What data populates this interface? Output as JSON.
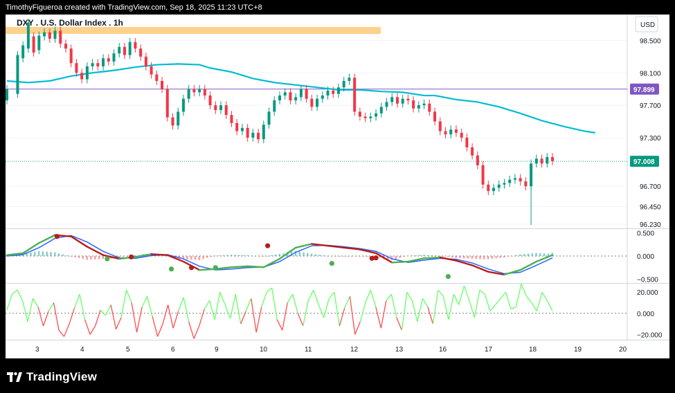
{
  "header": {
    "credit": "TimothyFigueroa created with TradingView.com, Sep 18, 2025 11:23 UTC+8"
  },
  "chart_data": {
    "type": "candlestick",
    "title": "DXY . U.S. Dollar Index . 1h",
    "currency": "USD",
    "x_tick_labels": [
      "3",
      "4",
      "5",
      "6",
      "9",
      "10",
      "11",
      "12",
      "13",
      "16",
      "17",
      "18",
      "19",
      "20"
    ],
    "main": {
      "y_ticks": [
        98.5,
        98.1,
        97.7,
        97.3,
        96.7,
        96.45,
        96.23
      ],
      "y_tick_labels": [
        "98.500",
        "98.100",
        "97.700",
        "97.300",
        "96.700",
        "96.450",
        "96.230"
      ],
      "ylim": [
        96.18,
        98.82
      ],
      "last_price": 97.008,
      "last_price_label": "97.008",
      "horizontal_level": 97.899,
      "horizontal_level_label": "97.899",
      "last_price_color": "#089981",
      "level_color": "#7E57C2",
      "moving_average_color": "#00BCD4",
      "moving_average": [
        [
          0,
          98.0
        ],
        [
          4,
          97.98
        ],
        [
          8,
          98.0
        ],
        [
          12,
          98.06
        ],
        [
          16,
          98.1
        ],
        [
          20,
          98.13
        ],
        [
          24,
          98.17
        ],
        [
          28,
          98.2
        ],
        [
          32,
          98.21
        ],
        [
          36,
          98.2
        ],
        [
          38,
          98.16
        ],
        [
          42,
          98.11
        ],
        [
          46,
          98.03
        ],
        [
          50,
          97.98
        ],
        [
          54,
          97.95
        ],
        [
          58,
          97.92
        ],
        [
          62,
          97.89
        ],
        [
          66,
          97.89
        ],
        [
          70,
          97.87
        ],
        [
          74,
          97.86
        ],
        [
          78,
          97.82
        ],
        [
          80,
          97.82
        ],
        [
          84,
          97.77
        ],
        [
          88,
          97.74
        ],
        [
          92,
          97.68
        ],
        [
          96,
          97.6
        ],
        [
          100,
          97.51
        ],
        [
          104,
          97.44
        ],
        [
          108,
          97.38
        ],
        [
          110,
          97.36
        ]
      ],
      "candles": [
        [
          0,
          97.76,
          97.9
        ],
        [
          2,
          97.84,
          98.32
        ],
        [
          3,
          98.28,
          98.44
        ],
        [
          4,
          98.4,
          98.72
        ],
        [
          5,
          98.55,
          98.35
        ],
        [
          6,
          98.38,
          98.56
        ],
        [
          7,
          98.55,
          98.6
        ],
        [
          8,
          98.6,
          98.52
        ],
        [
          9,
          98.52,
          98.62
        ],
        [
          10,
          98.62,
          98.46
        ],
        [
          11,
          98.46,
          98.4
        ],
        [
          12,
          98.4,
          98.22
        ],
        [
          13,
          98.22,
          98.1
        ],
        [
          14,
          98.1,
          98.02
        ],
        [
          15,
          98.02,
          98.18
        ],
        [
          16,
          98.18,
          98.22
        ],
        [
          17,
          98.22,
          98.18
        ],
        [
          18,
          98.18,
          98.28
        ],
        [
          19,
          98.28,
          98.24
        ],
        [
          20,
          98.24,
          98.34
        ],
        [
          21,
          98.34,
          98.42
        ],
        [
          22,
          98.42,
          98.32
        ],
        [
          23,
          98.32,
          98.48
        ],
        [
          24,
          98.48,
          98.4
        ],
        [
          25,
          98.4,
          98.3
        ],
        [
          26,
          98.3,
          98.18
        ],
        [
          27,
          98.18,
          98.08
        ],
        [
          28,
          98.08,
          98.0
        ],
        [
          29,
          98.0,
          97.9
        ],
        [
          30,
          97.9,
          97.55
        ],
        [
          31,
          97.55,
          97.45
        ],
        [
          32,
          97.45,
          97.62
        ],
        [
          33,
          97.62,
          97.78
        ],
        [
          34,
          97.78,
          97.9
        ],
        [
          35,
          97.9,
          97.86
        ],
        [
          36,
          97.86,
          97.9
        ],
        [
          37,
          97.9,
          97.82
        ],
        [
          38,
          97.82,
          97.7
        ],
        [
          39,
          97.7,
          97.64
        ],
        [
          40,
          97.64,
          97.7
        ],
        [
          41,
          97.7,
          97.58
        ],
        [
          42,
          97.58,
          97.48
        ],
        [
          43,
          97.48,
          97.38
        ],
        [
          44,
          97.38,
          97.42
        ],
        [
          45,
          97.42,
          97.3
        ],
        [
          46,
          97.3,
          97.36
        ],
        [
          47,
          97.36,
          97.28
        ],
        [
          48,
          97.28,
          97.46
        ],
        [
          49,
          97.46,
          97.62
        ],
        [
          50,
          97.62,
          97.76
        ],
        [
          51,
          97.76,
          97.82
        ],
        [
          52,
          97.82,
          97.86
        ],
        [
          53,
          97.86,
          97.76
        ],
        [
          54,
          97.76,
          97.8
        ],
        [
          55,
          97.8,
          97.9
        ],
        [
          56,
          97.9,
          97.78
        ],
        [
          57,
          97.78,
          97.68
        ],
        [
          58,
          97.68,
          97.78
        ],
        [
          59,
          97.78,
          97.82
        ],
        [
          60,
          97.82,
          97.88
        ],
        [
          61,
          97.88,
          97.84
        ],
        [
          62,
          97.84,
          97.92
        ],
        [
          63,
          97.92,
          98.0
        ],
        [
          64,
          98.0,
          98.04
        ],
        [
          65,
          98.04,
          97.62
        ],
        [
          66,
          97.62,
          97.56
        ],
        [
          67,
          97.56,
          97.54
        ],
        [
          68,
          97.54,
          97.56
        ],
        [
          69,
          97.56,
          97.6
        ],
        [
          70,
          97.6,
          97.68
        ],
        [
          71,
          97.68,
          97.74
        ],
        [
          72,
          97.74,
          97.8
        ],
        [
          73,
          97.8,
          97.72
        ],
        [
          74,
          97.72,
          97.78
        ],
        [
          75,
          97.78,
          97.76
        ],
        [
          76,
          97.76,
          97.66
        ],
        [
          77,
          97.66,
          97.7
        ],
        [
          78,
          97.7,
          97.72
        ],
        [
          79,
          97.72,
          97.62
        ],
        [
          80,
          97.62,
          97.5
        ],
        [
          81,
          97.5,
          97.38
        ],
        [
          82,
          97.38,
          97.34
        ],
        [
          83,
          97.34,
          97.4
        ],
        [
          84,
          97.4,
          97.36
        ],
        [
          85,
          97.36,
          97.3
        ],
        [
          86,
          97.3,
          97.18
        ],
        [
          87,
          97.18,
          97.08
        ],
        [
          88,
          97.08,
          96.96
        ],
        [
          89,
          96.96,
          96.72
        ],
        [
          90,
          96.72,
          96.64
        ],
        [
          91,
          96.64,
          96.68
        ],
        [
          92,
          96.68,
          96.72
        ],
        [
          93,
          96.72,
          96.74
        ],
        [
          94,
          96.74,
          96.78
        ],
        [
          95,
          96.78,
          96.8
        ],
        [
          96,
          96.8,
          96.76
        ],
        [
          97,
          96.76,
          96.7
        ],
        [
          98,
          96.7,
          96.98
        ],
        [
          99,
          96.98,
          97.04
        ],
        [
          100,
          97.04,
          96.98
        ],
        [
          101,
          96.98,
          97.06
        ],
        [
          102,
          97.06,
          97.01
        ]
      ]
    },
    "oscillator_1": {
      "y_ticks": [
        0.5,
        0.0,
        -0.5
      ],
      "y_tick_labels": [
        "0.500",
        "0.000",
        "−0.500"
      ],
      "ylim": [
        -0.58,
        0.58
      ],
      "fast_line": [
        [
          0,
          0.02
        ],
        [
          4,
          0.06
        ],
        [
          8,
          0.28
        ],
        [
          12,
          0.45
        ],
        [
          16,
          0.42
        ],
        [
          20,
          0.2
        ],
        [
          24,
          0.02
        ],
        [
          28,
          -0.06
        ],
        [
          32,
          -0.02
        ],
        [
          36,
          0.04
        ],
        [
          40,
          0.02
        ],
        [
          44,
          -0.12
        ],
        [
          48,
          -0.3
        ],
        [
          52,
          -0.28
        ],
        [
          56,
          -0.24
        ],
        [
          60,
          -0.22
        ],
        [
          64,
          -0.24
        ],
        [
          68,
          -0.06
        ],
        [
          72,
          0.18
        ],
        [
          76,
          0.26
        ],
        [
          80,
          0.22
        ],
        [
          84,
          0.18
        ],
        [
          88,
          0.14
        ],
        [
          92,
          0.06
        ],
        [
          96,
          -0.14
        ],
        [
          100,
          -0.12
        ],
        [
          104,
          -0.05
        ],
        [
          108,
          -0.03
        ],
        [
          112,
          -0.1
        ],
        [
          116,
          -0.2
        ],
        [
          120,
          -0.34
        ],
        [
          124,
          -0.4
        ],
        [
          128,
          -0.3
        ],
        [
          132,
          -0.12
        ],
        [
          136,
          0.02
        ]
      ],
      "slow_line": [
        [
          0,
          0.0
        ],
        [
          4,
          0.03
        ],
        [
          8,
          0.18
        ],
        [
          12,
          0.38
        ],
        [
          16,
          0.44
        ],
        [
          20,
          0.3
        ],
        [
          24,
          0.1
        ],
        [
          28,
          -0.04
        ],
        [
          32,
          -0.05
        ],
        [
          36,
          0.01
        ],
        [
          40,
          0.03
        ],
        [
          44,
          -0.06
        ],
        [
          48,
          -0.22
        ],
        [
          52,
          -0.3
        ],
        [
          56,
          -0.28
        ],
        [
          60,
          -0.25
        ],
        [
          64,
          -0.24
        ],
        [
          68,
          -0.12
        ],
        [
          72,
          0.08
        ],
        [
          76,
          0.22
        ],
        [
          80,
          0.23
        ],
        [
          84,
          0.2
        ],
        [
          88,
          0.16
        ],
        [
          92,
          0.1
        ],
        [
          96,
          -0.06
        ],
        [
          100,
          -0.14
        ],
        [
          104,
          -0.09
        ],
        [
          108,
          -0.05
        ],
        [
          112,
          -0.07
        ],
        [
          116,
          -0.15
        ],
        [
          120,
          -0.28
        ],
        [
          124,
          -0.38
        ],
        [
          128,
          -0.35
        ],
        [
          132,
          -0.2
        ],
        [
          136,
          -0.04
        ]
      ],
      "cross_markers": [
        [
          12.5,
          0.42,
          "red"
        ],
        [
          25,
          -0.06,
          "green"
        ],
        [
          31,
          -0.02,
          "red"
        ],
        [
          41,
          -0.28,
          "green"
        ],
        [
          46,
          -0.25,
          "red"
        ],
        [
          52,
          -0.25,
          "green"
        ],
        [
          65,
          0.22,
          "red"
        ],
        [
          81,
          -0.16,
          "green"
        ],
        [
          91,
          -0.05,
          "red"
        ],
        [
          92,
          -0.04,
          "red"
        ],
        [
          110,
          -0.44,
          "green"
        ]
      ]
    },
    "oscillator_2": {
      "y_ticks": [
        20,
        0,
        -20
      ],
      "y_tick_labels": [
        "20.000",
        "0.000",
        "−20.000"
      ],
      "ylim": [
        -25,
        28
      ],
      "values": [
        3,
        18,
        22,
        12,
        -8,
        14,
        6,
        -12,
        2,
        10,
        -16,
        -22,
        -10,
        5,
        18,
        -6,
        -20,
        -12,
        3,
        -2,
        8,
        -15,
        -4,
        22,
        10,
        -18,
        6,
        16,
        -3,
        -22,
        -10,
        8,
        -14,
        2,
        15,
        -8,
        -24,
        -12,
        4,
        12,
        -6,
        20,
        8,
        -5,
        18,
        -10,
        2,
        14,
        -18,
        6,
        20,
        24,
        -6,
        -16,
        10,
        18,
        0,
        -12,
        12,
        22,
        8,
        -4,
        14,
        20,
        -12,
        5,
        16,
        -20,
        -8,
        10,
        22,
        6,
        -14,
        12,
        18,
        -4,
        -16,
        20,
        12,
        -8,
        14,
        6,
        -10,
        22,
        16,
        -6,
        18,
        8,
        26,
        12,
        -4,
        22,
        18,
        2,
        8,
        14,
        20,
        4,
        6,
        28,
        16,
        10,
        2,
        20,
        12,
        2
      ]
    }
  }
}
